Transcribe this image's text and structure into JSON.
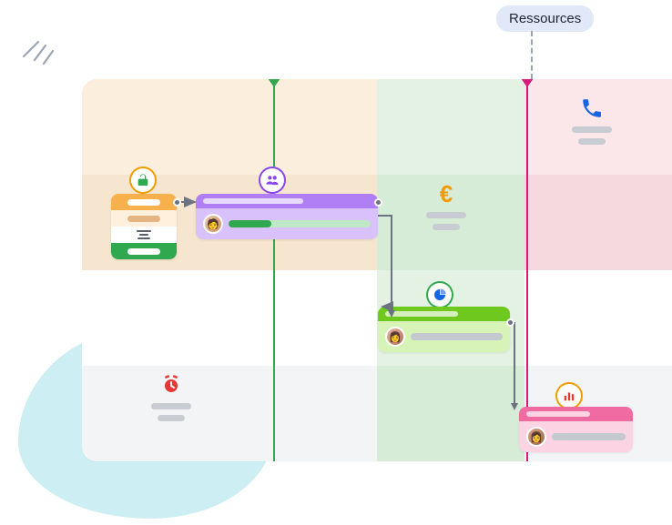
{
  "label": {
    "ressources": "Ressources"
  },
  "accent": {
    "green_marker": "#2fa84f",
    "pink_marker": "#d81b7a",
    "resources_tag_bg": "#e1e8f7"
  },
  "columns": [
    {
      "icon": "phone-icon",
      "color": "#1763e5"
    },
    {
      "icon": "euro-icon",
      "color": "#f29b00"
    },
    {
      "icon": "clock-icon",
      "color": "#e53935"
    }
  ],
  "bubbles": [
    {
      "icon": "unlock-icon",
      "ring": "#f29b00",
      "glyph": "#2fa84f"
    },
    {
      "icon": "people-icon",
      "ring": "#8a46e8",
      "glyph": "#8a46e8"
    },
    {
      "icon": "pie-chart-icon",
      "ring": "#2fa84f",
      "glyph": "#1763e5"
    },
    {
      "icon": "bar-chart-icon",
      "ring": "#f29b00",
      "glyph": "#e53935"
    }
  ],
  "cards": {
    "mini": {
      "rows": [
        {
          "bg": "#f7b04b",
          "pill": "#ffffff"
        },
        {
          "bg": "#fff0dd",
          "pill": "#d8905a"
        },
        {
          "bg": "#ffffff",
          "pill": "#585f6b",
          "glyph": "align-center-icon"
        },
        {
          "bg": "#2fa84f",
          "pill": "#ffffff"
        }
      ]
    },
    "purple": {
      "header_bg": "#b07ff5",
      "body_bg": "#d9c2fb",
      "track_bg": "#bfe8c6",
      "fill_bg": "#2fa84f",
      "progress": 0.3
    },
    "green": {
      "header_bg": "#6ec81e",
      "body_bg": "#d8f3b7",
      "track_bg": "#c4c9d0",
      "fill_bg": "#8a8f98",
      "progress": 0.0
    },
    "pink": {
      "header_bg": "#f06ba2",
      "body_bg": "#fcd3e3",
      "track_bg": "#c4c9d0",
      "fill_bg": "#8a8f98",
      "progress": 0.0
    }
  }
}
